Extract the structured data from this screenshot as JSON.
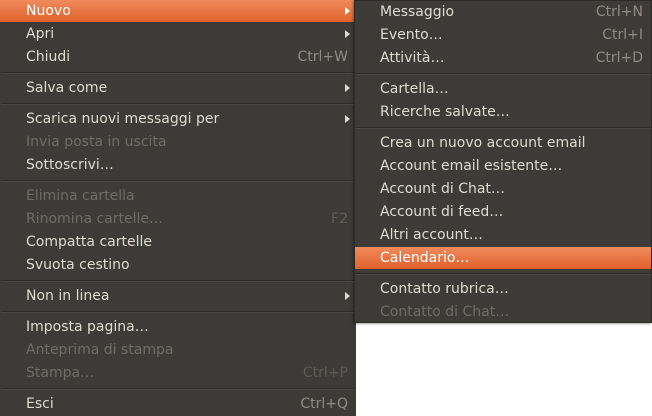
{
  "main_menu": {
    "new": {
      "label": "Nuovo"
    },
    "open": {
      "label": "Apri"
    },
    "close": {
      "label": "Chiudi",
      "accel": "Ctrl+W"
    },
    "save_as": {
      "label": "Salva come"
    },
    "get_new_messages": {
      "label": "Scarica nuovi messaggi per"
    },
    "send_unsent": {
      "label": "Invia posta in uscita"
    },
    "subscribe": {
      "label": "Sottoscrivi…"
    },
    "delete_folder": {
      "label": "Elimina cartella"
    },
    "rename_folder": {
      "label": "Rinomina cartelle…",
      "accel": "F2"
    },
    "compact_folders": {
      "label": "Compatta cartelle"
    },
    "empty_trash": {
      "label": "Svuota cestino"
    },
    "offline": {
      "label": "Non in linea"
    },
    "page_setup": {
      "label": "Imposta pagina…"
    },
    "print_preview": {
      "label": "Anteprima di stampa"
    },
    "print": {
      "label": "Stampa…",
      "accel": "Ctrl+P"
    },
    "quit": {
      "label": "Esci",
      "accel": "Ctrl+Q"
    }
  },
  "submenu_new": {
    "message": {
      "label": "Messaggio",
      "accel": "Ctrl+N"
    },
    "event": {
      "label": "Evento…",
      "accel": "Ctrl+I"
    },
    "task": {
      "label": "Attività…",
      "accel": "Ctrl+D"
    },
    "folder": {
      "label": "Cartella…"
    },
    "saved_search": {
      "label": "Ricerche salvate…"
    },
    "new_email_account": {
      "label": "Crea un nuovo account email"
    },
    "existing_email_account": {
      "label": "Account email esistente…"
    },
    "chat_account": {
      "label": "Account di Chat…"
    },
    "feed_account": {
      "label": "Account di feed…"
    },
    "other_accounts": {
      "label": "Altri account…"
    },
    "calendar": {
      "label": "Calendario…"
    },
    "address_book_contact": {
      "label": "Contatto rubrica…"
    },
    "chat_contact": {
      "label": "Contatto di Chat…"
    }
  },
  "colors": {
    "menu_bg": "#3c3b37",
    "highlight": "#e8703f",
    "text": "#dfdbd2",
    "disabled_text": "#6f6c66"
  }
}
